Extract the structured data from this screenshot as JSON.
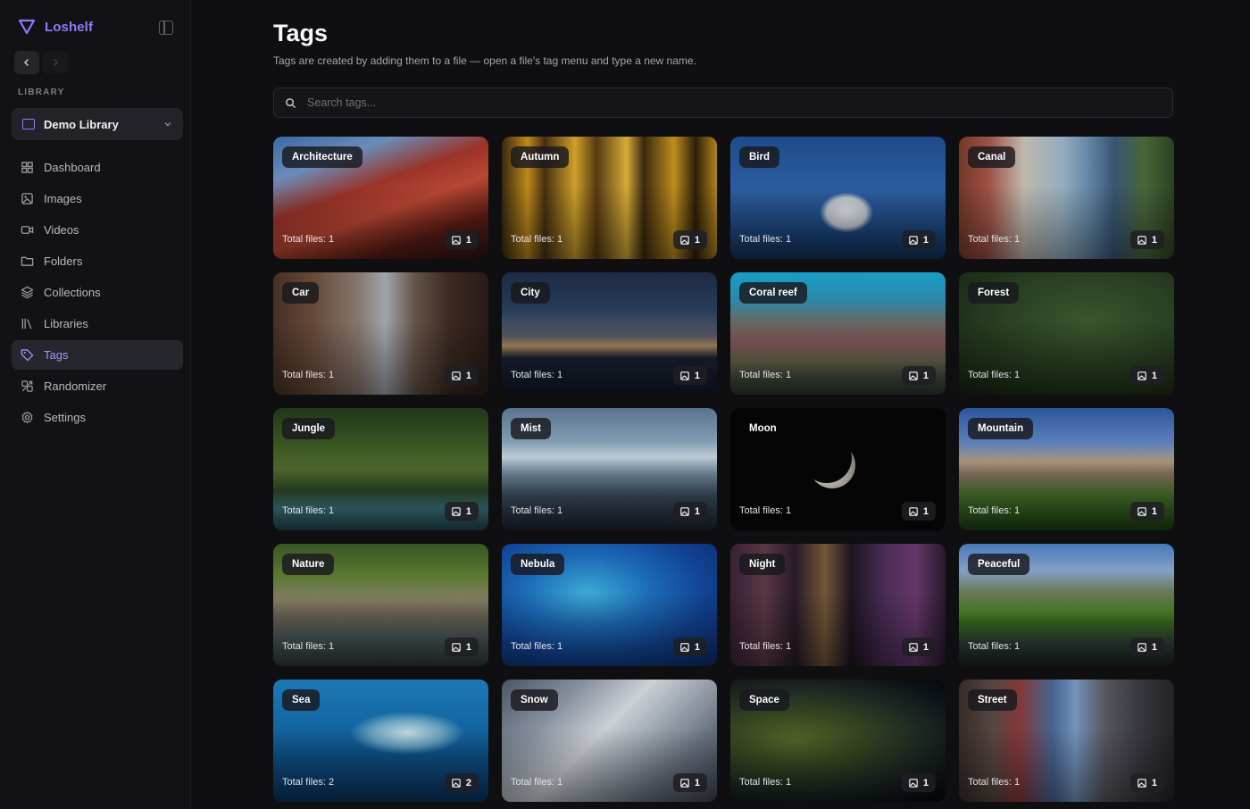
{
  "app": {
    "name": "Loshelf"
  },
  "sidebar": {
    "section_label": "LIBRARY",
    "library_select": "Demo Library",
    "items": [
      {
        "label": "Dashboard",
        "icon": "dashboard-icon"
      },
      {
        "label": "Images",
        "icon": "image-icon"
      },
      {
        "label": "Videos",
        "icon": "video-icon"
      },
      {
        "label": "Folders",
        "icon": "folder-icon"
      },
      {
        "label": "Collections",
        "icon": "layers-icon"
      },
      {
        "label": "Libraries",
        "icon": "library-icon"
      },
      {
        "label": "Tags",
        "icon": "tag-icon",
        "active": true
      },
      {
        "label": "Randomizer",
        "icon": "shuffle-icon"
      },
      {
        "label": "Settings",
        "icon": "gear-icon"
      }
    ]
  },
  "page": {
    "title": "Tags",
    "subtitle": "Tags are created by adding them to a file — open a file's tag menu and type a new name.",
    "search_placeholder": "Search tags..."
  },
  "colors": {
    "accent": "#8b7bff",
    "background": "#0f0f11",
    "sidebar": "#121215"
  },
  "tags": [
    {
      "name": "Architecture",
      "total": "Total files: 1",
      "count": "1"
    },
    {
      "name": "Autumn",
      "total": "Total files: 1",
      "count": "1"
    },
    {
      "name": "Bird",
      "total": "Total files: 1",
      "count": "1"
    },
    {
      "name": "Canal",
      "total": "Total files: 1",
      "count": "1"
    },
    {
      "name": "Car",
      "total": "Total files: 1",
      "count": "1"
    },
    {
      "name": "City",
      "total": "Total files: 1",
      "count": "1"
    },
    {
      "name": "Coral reef",
      "total": "Total files: 1",
      "count": "1"
    },
    {
      "name": "Forest",
      "total": "Total files: 1",
      "count": "1"
    },
    {
      "name": "Jungle",
      "total": "Total files: 1",
      "count": "1"
    },
    {
      "name": "Mist",
      "total": "Total files: 1",
      "count": "1"
    },
    {
      "name": "Moon",
      "total": "Total files: 1",
      "count": "1"
    },
    {
      "name": "Mountain",
      "total": "Total files: 1",
      "count": "1"
    },
    {
      "name": "Nature",
      "total": "Total files: 1",
      "count": "1"
    },
    {
      "name": "Nebula",
      "total": "Total files: 1",
      "count": "1"
    },
    {
      "name": "Night",
      "total": "Total files: 1",
      "count": "1"
    },
    {
      "name": "Peaceful",
      "total": "Total files: 1",
      "count": "1"
    },
    {
      "name": "Sea",
      "total": "Total files: 2",
      "count": "2"
    },
    {
      "name": "Snow",
      "total": "Total files: 1",
      "count": "1"
    },
    {
      "name": "Space",
      "total": "Total files: 1",
      "count": "1"
    },
    {
      "name": "Street",
      "total": "Total files: 1",
      "count": "1"
    }
  ]
}
